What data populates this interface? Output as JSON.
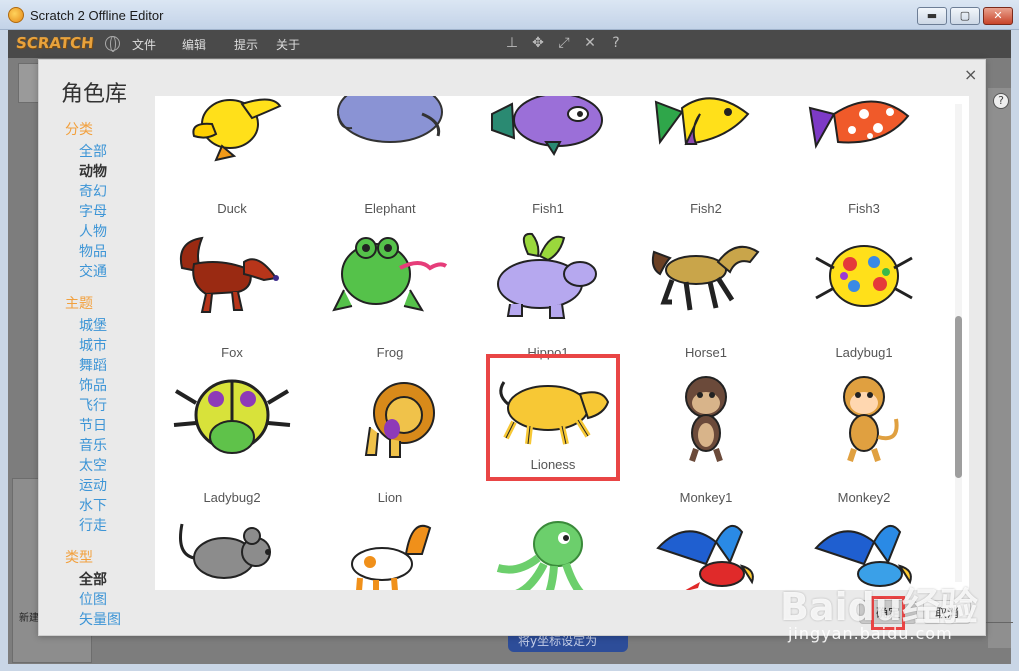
{
  "window": {
    "title": "Scratch 2 Offline Editor",
    "min_label": "▬",
    "max_label": "▢",
    "close_label": "✕"
  },
  "menubar": {
    "logo": "SCRATCH",
    "menus": [
      "文件",
      "编辑",
      "提示",
      "关于"
    ]
  },
  "dialog": {
    "title": "角色库",
    "close": "×",
    "ok_label": "确定",
    "cancel_label": "取消"
  },
  "categories": {
    "group1": {
      "heading": "分类",
      "items": [
        "全部",
        "动物",
        "奇幻",
        "字母",
        "人物",
        "物品",
        "交通"
      ],
      "selected": "动物"
    },
    "group2": {
      "heading": "主题",
      "items": [
        "城堡",
        "城市",
        "舞蹈",
        "饰品",
        "飞行",
        "节日",
        "音乐",
        "太空",
        "运动",
        "水下",
        "行走"
      ]
    },
    "group3": {
      "heading": "类型",
      "items": [
        "全部",
        "位图",
        "矢量图"
      ],
      "selected": "全部"
    }
  },
  "sprites": {
    "row1": [
      "Duck",
      "Elephant",
      "Fish1",
      "Fish2",
      "Fish3"
    ],
    "row2": [
      "Fox",
      "Frog",
      "Hippo1",
      "Horse1",
      "Ladybug1"
    ],
    "row3": [
      "Ladybug2",
      "Lion",
      "Lioness",
      "Monkey1",
      "Monkey2"
    ],
    "row4": [
      "",
      "",
      "",
      "",
      ""
    ],
    "selected": "Lioness"
  },
  "background": {
    "sprite_label": "新建",
    "block_text": "将y坐标设定为"
  },
  "watermark": {
    "main": "Baidu经验",
    "sub": "jingyan.baidu.com"
  },
  "colors": {
    "accent_orange": "#f2a03d",
    "link_blue": "#3d95d6",
    "highlight_red": "#e94545"
  }
}
